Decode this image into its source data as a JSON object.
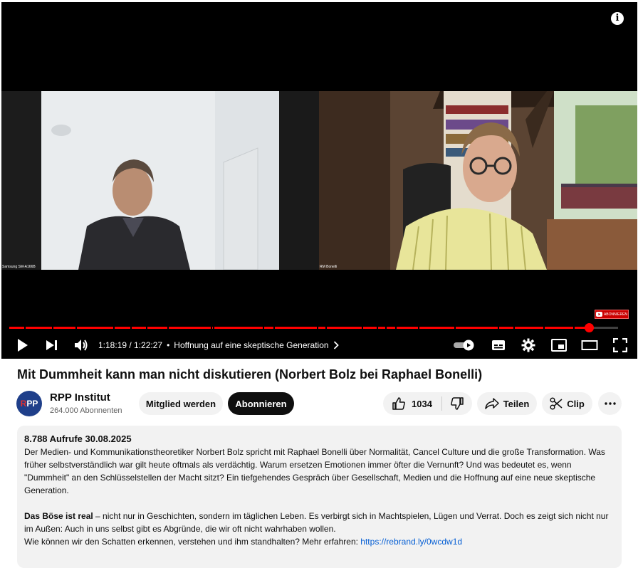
{
  "player": {
    "left_frame_label": "Samsung SM-A166B",
    "right_frame_label": "RM Bonelli",
    "subscribe_badge": "ABONNIEREN",
    "progress_fraction": 0.9518,
    "time_display": "1:18:19 / 1:22:27",
    "chapter_title": "Hoffnung auf eine skeptische Generation",
    "accent_color": "#ff0000"
  },
  "video": {
    "title": "Mit Dummheit kann man nicht diskutieren (Norbert Bolz bei Raphael Bonelli)"
  },
  "channel": {
    "avatar_text_left": "R",
    "avatar_text_right": "PP",
    "name": "RPP Institut",
    "subscribers": "264.000 Abonnenten"
  },
  "actions": {
    "member_label": "Mitglied werden",
    "subscribe_label": "Abonnieren",
    "like_count": "1034",
    "share_label": "Teilen",
    "clip_label": "Clip"
  },
  "description": {
    "meta": "8.788 Aufrufe  30.08.2025",
    "paragraph1": "Der Medien- und Kommunikationstheoretiker Norbert Bolz spricht mit Raphael Bonelli über Normalität, Cancel Culture und die große Transformation. Was früher selbstverständlich war gilt heute oftmals als verdächtig. Warum ersetzen Emotionen immer öfter die Vernunft? Und was bedeutet es, wenn \"Dummheit\" an den Schlüsselstellen der Macht sitzt? Ein tiefgehendes Gespräch über Gesellschaft, Medien und die Hoffnung auf eine neue skeptische Generation.",
    "bold_lead": "Das Böse ist real",
    "paragraph2_rest": " – nicht nur in Geschichten, sondern im täglichen Leben. Es verbirgt sich in Machtspielen, Lügen und Verrat. Doch es zeigt sich nicht nur im Außen: Auch in uns selbst gibt es Abgründe, die wir oft nicht wahrhaben wollen.",
    "paragraph3": "Wie können wir den Schatten erkennen, verstehen und ihm standhalten? Mehr erfahren: ",
    "link": "https://rebrand.ly/0wcdw1d"
  }
}
